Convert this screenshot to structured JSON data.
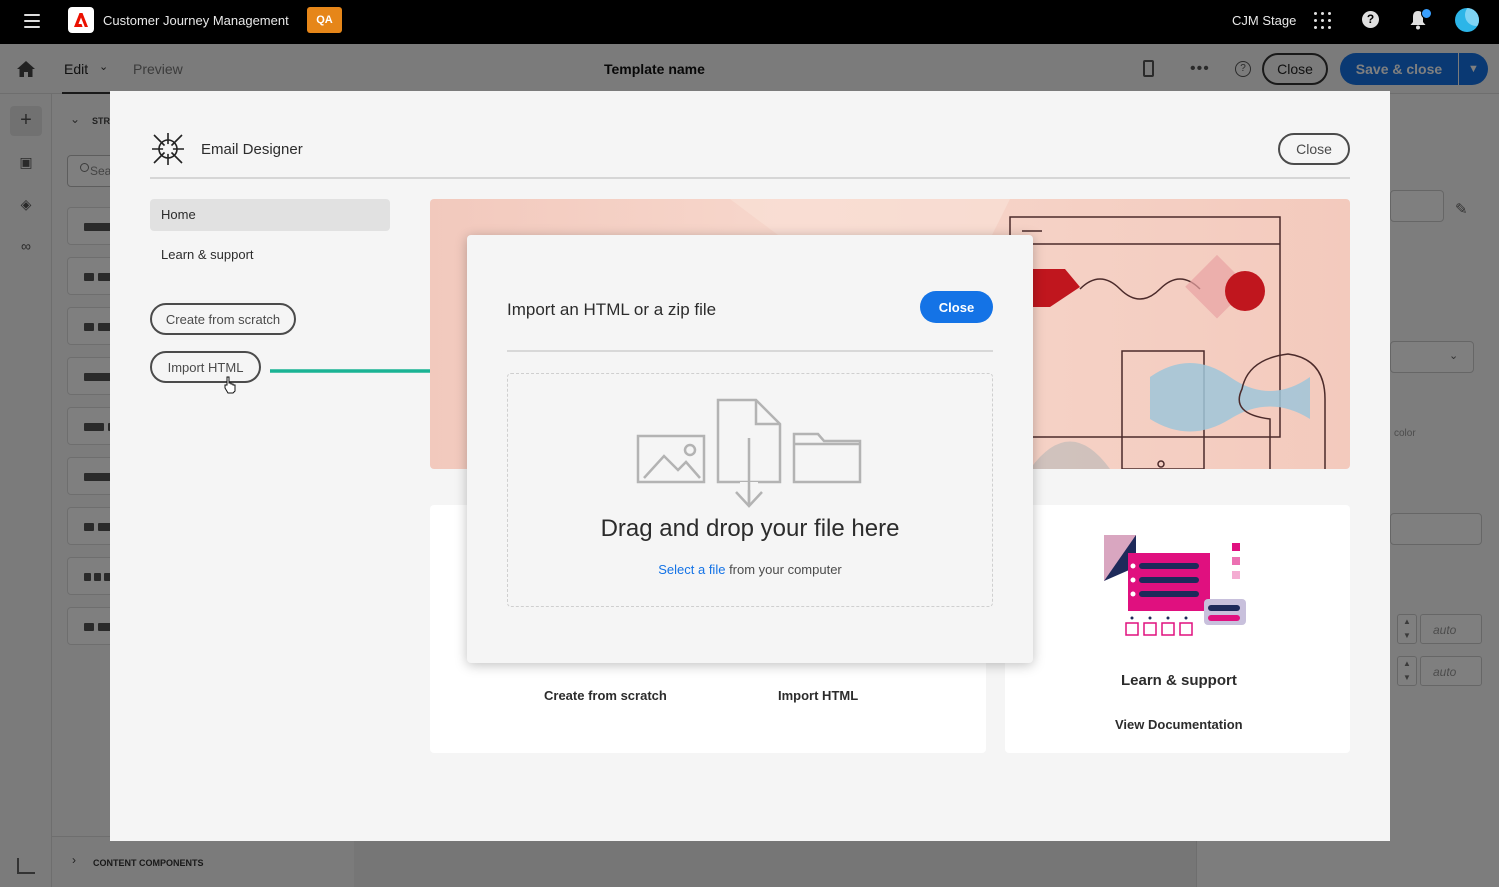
{
  "topbar": {
    "app_title": "Customer Journey Management",
    "env_badge": "QA",
    "env_label": "CJM Stage"
  },
  "editor": {
    "tab_edit": "Edit",
    "tab_preview": "Preview",
    "template_name": "Template name",
    "close_label": "Close",
    "save_close_label": "Save & close",
    "structures_label": "STR",
    "search_placeholder": "Sea",
    "content_components_label": "CONTENT COMPONENTS",
    "right_panel": {
      "color_label": "color",
      "width_value": "auto",
      "height_value": "auto"
    }
  },
  "designer": {
    "title": "Email Designer",
    "close_label": "Close",
    "nav": [
      {
        "label": "Home",
        "active": true
      },
      {
        "label": "Learn & support",
        "active": false
      }
    ],
    "create_from_scratch": "Create from scratch",
    "import_html": "Import HTML",
    "cards": {
      "create_from_scratch": "Create from scratch",
      "import_html": "Import HTML",
      "learn_title": "Learn & support",
      "view_documentation": "View Documentation"
    }
  },
  "import_dialog": {
    "title": "Import an HTML or a zip file",
    "close_label": "Close",
    "drop_title": "Drag and drop your file here",
    "select_link": "Select a file",
    "select_suffix": "from your computer"
  },
  "colors": {
    "accent": "#1473e6",
    "qa_badge": "#e68619",
    "arrow": "#1ab394",
    "hero_bg": "#f2c9bd"
  },
  "icons": [
    "menu-icon",
    "adobe-logo",
    "apps-grid-icon",
    "help-icon",
    "bell-icon",
    "avatar",
    "home-icon",
    "mobile-preview-icon",
    "more-icon",
    "email-designer-logo",
    "cursor-icon",
    "image-icon",
    "file-download-icon",
    "folder-icon"
  ]
}
